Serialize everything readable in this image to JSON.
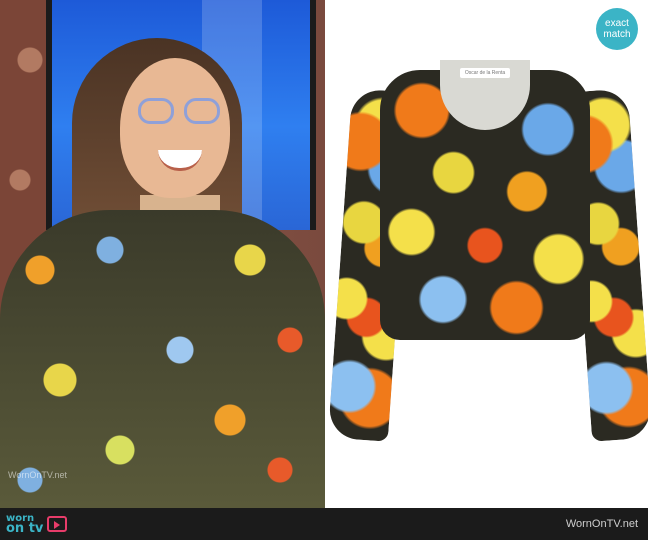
{
  "badge": {
    "line1": "exact",
    "line2": "match"
  },
  "footer": {
    "logo_line1": "worn",
    "logo_line2": "on tv",
    "site": "WornOnTV.net"
  },
  "photo": {
    "watermark": "WornOnTV.net"
  },
  "product": {
    "brand_label": "Oscar de la Renta"
  },
  "colors": {
    "badge": "#3bb4c6",
    "footer_bg": "#1b1b1b",
    "logo_accent": "#e83c6a"
  }
}
